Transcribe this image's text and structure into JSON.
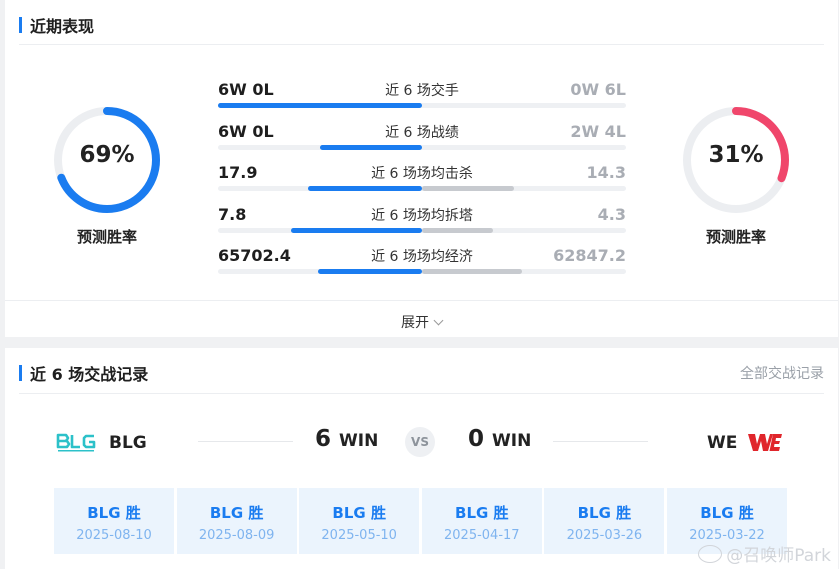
{
  "recent": {
    "title": "近期表现",
    "left_gauge": {
      "value": "69%",
      "percent": 69,
      "label": "预测胜率",
      "color": "#1a7cf0"
    },
    "right_gauge": {
      "value": "31%",
      "percent": 31,
      "label": "预测胜率",
      "color": "#f0466b"
    },
    "stats": [
      {
        "label": "近 6 场交手",
        "left": "6W 0L",
        "right": "0W 6L",
        "left_share": 1.0,
        "right_share": 0.0
      },
      {
        "label": "近 6 场战绩",
        "left": "6W 0L",
        "right": "2W 4L",
        "left_share": 0.5,
        "right_share": 0.0
      },
      {
        "label": "近 6 场场均击杀",
        "left": "17.9",
        "right": "14.3",
        "left_share": 0.56,
        "right_share": 0.45
      },
      {
        "label": "近 6 场场均拆塔",
        "left": "7.8",
        "right": "4.3",
        "left_share": 0.64,
        "right_share": 0.35
      },
      {
        "label": "近 6 场场均经济",
        "left": "65702.4",
        "right": "62847.2",
        "left_share": 0.51,
        "right_share": 0.49
      }
    ],
    "expand_label": "展开"
  },
  "history": {
    "title": "近 6 场交战记录",
    "all_link": "全部交战记录",
    "team_left": {
      "name": "BLG",
      "wins": "6",
      "win_label": "WIN"
    },
    "team_right": {
      "name": "WE",
      "wins": "0",
      "win_label": "WIN"
    },
    "vs": "VS",
    "matches": [
      {
        "result": "BLG 胜",
        "date": "2025-08-10"
      },
      {
        "result": "BLG 胜",
        "date": "2025-08-09"
      },
      {
        "result": "BLG 胜",
        "date": "2025-05-10"
      },
      {
        "result": "BLG 胜",
        "date": "2025-04-17"
      },
      {
        "result": "BLG 胜",
        "date": "2025-03-26"
      },
      {
        "result": "BLG 胜",
        "date": "2025-03-22"
      }
    ]
  },
  "watermark": "@召唤师Park",
  "colors": {
    "accent": "#1a7cf0",
    "danger": "#f0466b",
    "muted": "#a9adb4"
  }
}
